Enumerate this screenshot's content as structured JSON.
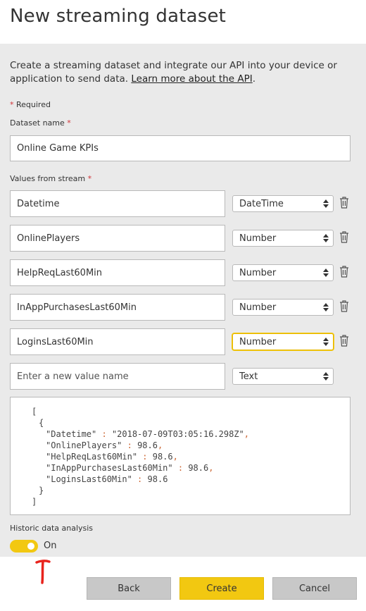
{
  "title": "New streaming dataset",
  "description": {
    "text": "Create a streaming dataset and integrate our API into your device or application to send data. ",
    "link": "Learn more about the API",
    "end": "."
  },
  "required_note": {
    "star": "*",
    "text": " Required"
  },
  "dataset_name": {
    "label": "Dataset name",
    "star": "*",
    "value": "Online Game KPIs"
  },
  "values_label": {
    "label": "Values from stream",
    "star": "*"
  },
  "fields": [
    {
      "name": "Datetime",
      "type": "DateTime"
    },
    {
      "name": "OnlinePlayers",
      "type": "Number"
    },
    {
      "name": "HelpReqLast60Min",
      "type": "Number"
    },
    {
      "name": "InAppPurchasesLast60Min",
      "type": "Number"
    },
    {
      "name": "LoginsLast60Min",
      "type": "Number"
    }
  ],
  "new_value": {
    "placeholder": "Enter a new value name",
    "type": "Text"
  },
  "json_sample": {
    "open": "[",
    "brace_open": "{",
    "lines": [
      {
        "key": "\"Datetime\"",
        "sep": " : ",
        "val": "\"2018-07-09T03:05:16.298Z\"",
        "comma": ","
      },
      {
        "key": "\"OnlinePlayers\"",
        "sep": " : ",
        "val": "98.6",
        "comma": ","
      },
      {
        "key": "\"HelpReqLast60Min\"",
        "sep": " : ",
        "val": "98.6",
        "comma": ","
      },
      {
        "key": "\"InAppPurchasesLast60Min\"",
        "sep": " : ",
        "val": "98.6",
        "comma": ","
      },
      {
        "key": "\"LoginsLast60Min\"",
        "sep": " : ",
        "val": "98.6",
        "comma": ""
      }
    ],
    "brace_close": "}",
    "close": "]"
  },
  "historic": {
    "label": "Historic data analysis",
    "state": "On",
    "enabled": true
  },
  "buttons": {
    "back": "Back",
    "create": "Create",
    "cancel": "Cancel"
  },
  "colors": {
    "accent": "#f2c811",
    "required": "#d13438",
    "annotation": "#e8231c"
  }
}
